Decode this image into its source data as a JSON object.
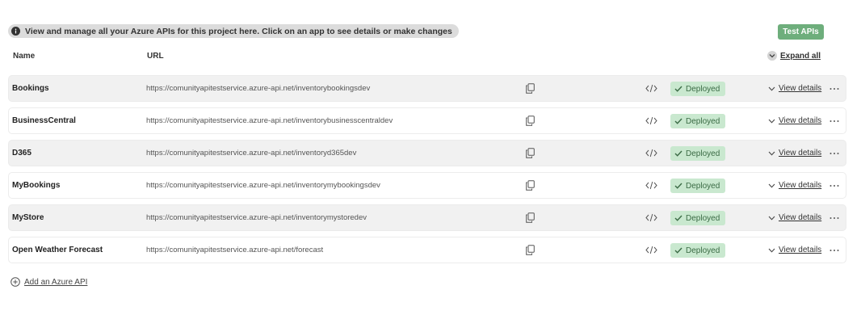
{
  "banner": {
    "text": "View and manage all your Azure APIs for this project here. Click on an app to see details or make changes",
    "icon": "info-icon"
  },
  "toolbar": {
    "test_label": "Test APIs",
    "test_color": "#6eae7c"
  },
  "table": {
    "headers": {
      "name": "Name",
      "url": "URL"
    },
    "expand_label": "Expand all",
    "rows": [
      {
        "name": "Bookings",
        "url": "https://comunityapitestservice.azure-api.net/inventorybookingsdev",
        "status": "Deployed",
        "details": "View details"
      },
      {
        "name": "BusinessCentral",
        "url": "https://comunityapitestservice.azure-api.net/inventorybusinesscentraldev",
        "status": "Deployed",
        "details": "View details"
      },
      {
        "name": "D365",
        "url": "https://comunityapitestservice.azure-api.net/inventoryd365dev",
        "status": "Deployed",
        "details": "View details"
      },
      {
        "name": "MyBookings",
        "url": "https://comunityapitestservice.azure-api.net/inventorymybookingsdev",
        "status": "Deployed",
        "details": "View details"
      },
      {
        "name": "MyStore",
        "url": "https://comunityapitestservice.azure-api.net/inventorymystoredev",
        "status": "Deployed",
        "details": "View details"
      },
      {
        "name": "Open Weather Forecast",
        "url": "https://comunityapitestservice.azure-api.net/forecast",
        "status": "Deployed",
        "details": "View details"
      }
    ]
  },
  "footer": {
    "add_label": "Add an Azure API"
  },
  "colors": {
    "deployed_bg": "#c9e8cf",
    "deployed_text": "#3b6b45",
    "row_shaded": "#f1f1f1"
  }
}
